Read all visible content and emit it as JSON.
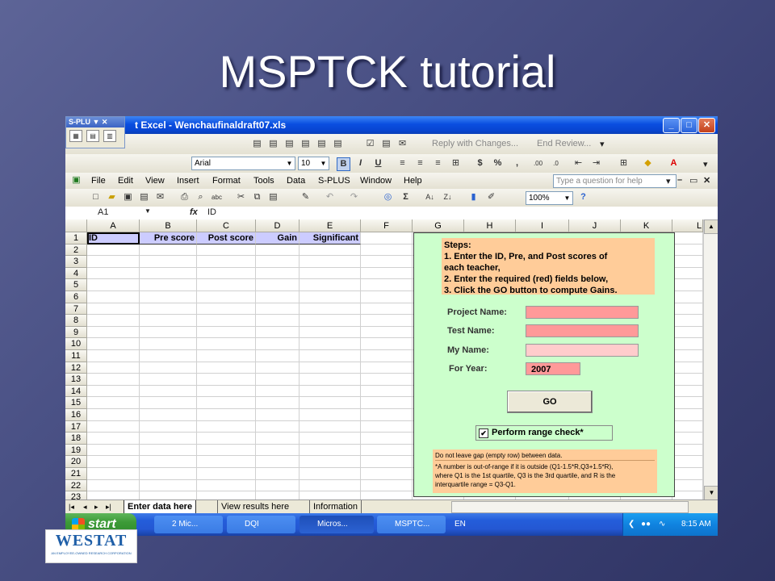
{
  "slide": {
    "title": "MSPTCK tutorial"
  },
  "window": {
    "title": "t Excel - Wenchaufinaldraft07.xls",
    "min": "_",
    "max": "□",
    "close": "✕"
  },
  "splus_toolbar": {
    "label": "S-PLU ▼ ✕"
  },
  "reviewing_toolbar": {
    "reply": "Reply with Changes...",
    "end_review": "End Review..."
  },
  "formatting": {
    "font": "Arial",
    "size": "10",
    "bold": "B",
    "italic": "I",
    "underline": "U",
    "currency": "$",
    "percent": "%",
    "comma": ","
  },
  "menu": {
    "items": [
      "File",
      "Edit",
      "View",
      "Insert",
      "Format",
      "Tools",
      "Data",
      "S-PLUS",
      "Window",
      "Help"
    ],
    "help_placeholder": "Type a question for help"
  },
  "standard": {
    "sigma": "Σ",
    "zoom": "100%",
    "help": "?"
  },
  "formula_bar": {
    "name_box": "A1",
    "fx": "fx",
    "value": "ID"
  },
  "sheet": {
    "columns": [
      "A",
      "B",
      "C",
      "D",
      "E",
      "F",
      "G",
      "H",
      "I",
      "J",
      "K",
      "L"
    ],
    "rows": [
      "1",
      "2",
      "3",
      "4",
      "5",
      "6",
      "7",
      "8",
      "9",
      "10",
      "11",
      "12",
      "13",
      "14",
      "15",
      "16",
      "17",
      "18",
      "19",
      "20",
      "21",
      "22",
      "23"
    ],
    "row1": [
      "ID",
      "Pre score",
      "Post score",
      "Gain",
      "Significant"
    ]
  },
  "panel": {
    "steps": [
      "Steps:",
      "1. Enter the ID, Pre, and Post scores of",
      "each teacher,",
      "2. Enter the required (red) fields below,",
      "3. Click the GO button to compute Gains."
    ],
    "project_label": "Project Name:",
    "test_label": "Test Name:",
    "myname_label": "My Name:",
    "year_label": "For Year:",
    "year_value": "2007",
    "go_label": "GO",
    "range_check": "Perform range check*",
    "check_mark": "✔",
    "note_lines": [
      "Do not leave gap (empty row) between data.",
      "*A number is out-of-range if it is outside (Q1-1.5*R,Q3+1.5*R),",
      "where Q1 is the 1st quartile, Q3 is the 3rd quartile, and R is the",
      "interquartile range = Q3-Q1."
    ]
  },
  "tabs": {
    "active": "Enter data here",
    "view": "View results here",
    "info": "Information"
  },
  "taskbar": {
    "start": "start",
    "items": [
      "2 Mic...",
      "DQI",
      "Micros...",
      "MSPTC..."
    ],
    "lang": "EN",
    "clock": "8:15 AM"
  },
  "logo": {
    "text": "WESTAT",
    "tagline": "AN EMPLOYEE-OWNED RESEARCH CORPORATION"
  },
  "colors": {
    "panel": "#ccffcc",
    "steps": "#ffcc99",
    "required": "#ff9999",
    "title_bar": "#0a4ee0"
  }
}
